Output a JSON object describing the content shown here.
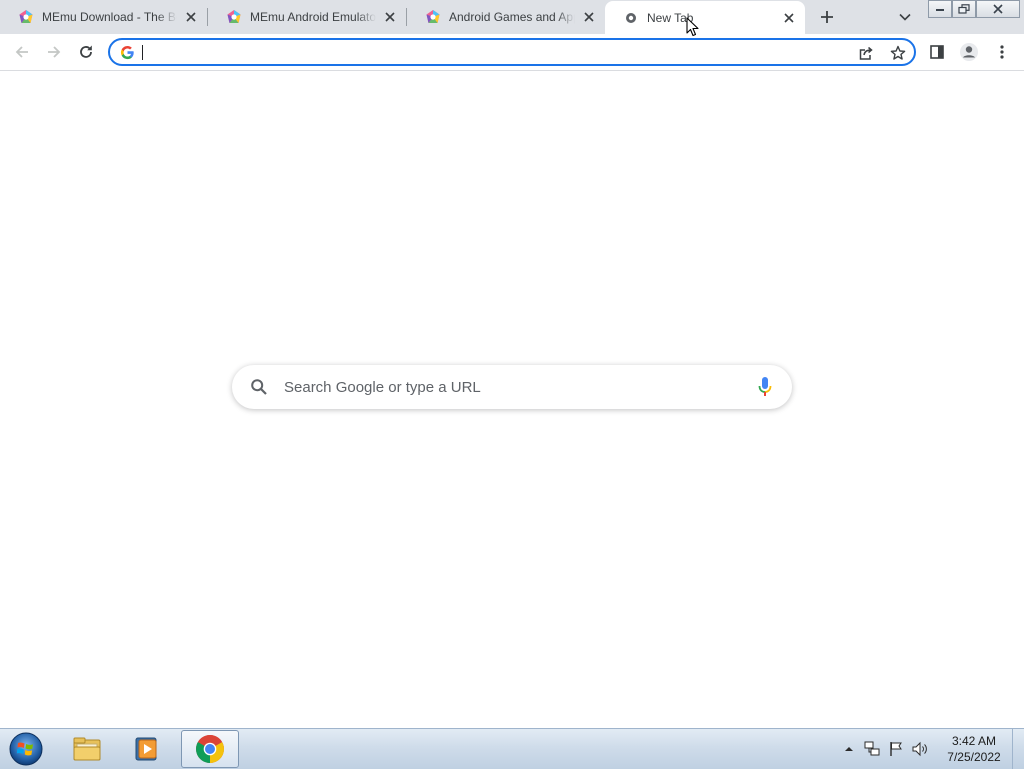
{
  "browser": {
    "tabs": [
      {
        "title": "MEmu Download - The Best Android Emulator",
        "active": false,
        "favicon": "memu-logo-icon"
      },
      {
        "title": "MEmu Android Emulator",
        "active": false,
        "favicon": "memu-logo-icon"
      },
      {
        "title": "Android Games and Apps",
        "active": false,
        "favicon": "memu-logo-icon"
      },
      {
        "title": "New Tab",
        "active": true,
        "favicon": "chrome-newtab-icon"
      }
    ],
    "new_tab_icon": "plus-icon",
    "tab_search_icon": "chevron-down-icon",
    "window_controls": [
      "minimize-icon",
      "restore-icon",
      "close-icon"
    ]
  },
  "toolbar": {
    "back_icon": "arrow-left-icon",
    "forward_icon": "arrow-right-icon",
    "reload_icon": "reload-icon",
    "omnibox": {
      "value": "",
      "placeholder": ""
    },
    "share_icon": "share-icon",
    "bookmark_icon": "star-icon",
    "side_panel_icon": "side-panel-icon",
    "profile_icon": "person-icon",
    "menu_icon": "kebab-menu-icon"
  },
  "ntp": {
    "search_placeholder": "Search Google or type a URL",
    "search_icon": "search-icon",
    "voice_icon": "microphone-icon"
  },
  "taskbar": {
    "apps": [
      "windows-explorer-icon",
      "media-player-icon",
      "chrome-icon"
    ],
    "active_app": "chrome-icon",
    "tray_icons": [
      "show-hidden-icons-arrow",
      "network-icon",
      "action-center-flag-icon",
      "volume-icon"
    ],
    "clock": {
      "time": "3:42 AM",
      "date": "7/25/2022"
    }
  },
  "colors": {
    "tabstrip_bg": "#dee1e6",
    "omnibox_focus": "#1a73e8",
    "taskbar_bg": "#cfdcea"
  }
}
